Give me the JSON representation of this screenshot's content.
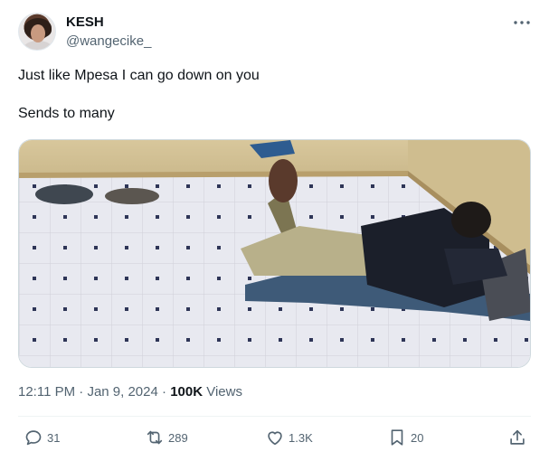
{
  "author": {
    "display_name": "KESH",
    "handle": "@wangecike_"
  },
  "tweet": {
    "line1": "Just like Mpesa I can go down on you",
    "line2": "Sends to many"
  },
  "meta": {
    "time": "12:11 PM",
    "separator1": " · ",
    "date": "Jan 9, 2024",
    "separator2": " · ",
    "views_count": "100K",
    "views_label": " Views"
  },
  "actions": {
    "replies": "31",
    "retweets": "289",
    "likes": "1.3K",
    "bookmarks": "20"
  },
  "icons": {
    "more": "more-horizontal-icon",
    "reply": "reply-icon",
    "retweet": "retweet-icon",
    "like": "heart-icon",
    "bookmark": "bookmark-icon",
    "share": "share-icon"
  },
  "colors": {
    "text": "#0f1419",
    "secondary": "#536471",
    "border": "#cfd9de"
  }
}
